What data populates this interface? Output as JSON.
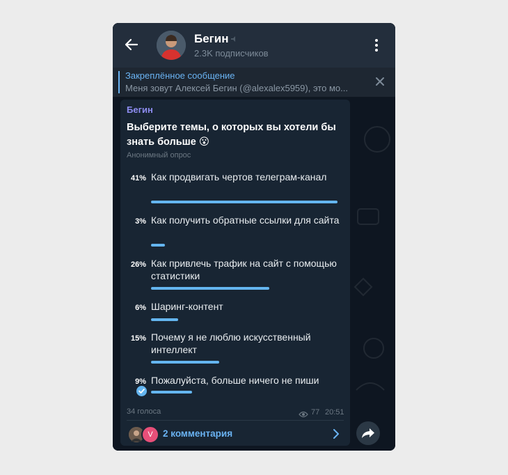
{
  "header": {
    "title": "Бегин",
    "subtitle": "2.3K подписчиков"
  },
  "pinned": {
    "title": "Закреплённое сообщение",
    "text": "Меня зовут Алексей Бегин (@alexalex5959), это мо..."
  },
  "message": {
    "author": "Бегин",
    "question": "Выберите темы, о которых вы хотели бы знать больше 😮",
    "poll_type": "Анонимный опрос",
    "options": [
      {
        "percent": "41%",
        "text": "Как продвигать чертов телеграм-канал",
        "fraction": 0.41
      },
      {
        "percent": "3%",
        "text": "Как получить обратные ссылки для сайта",
        "fraction": 0.03
      },
      {
        "percent": "26%",
        "text": "Как привлечь трафик на сайт с помощью статистики",
        "fraction": 0.26
      },
      {
        "percent": "6%",
        "text": "Шаринг-контент",
        "fraction": 0.06
      },
      {
        "percent": "15%",
        "text": "Почему я не люблю искусственный интеллект",
        "fraction": 0.15
      },
      {
        "percent": "9%",
        "text": "Пожалуйста, больше ничего не пиши",
        "fraction": 0.09,
        "selected": true
      }
    ],
    "votes": "34 голоса",
    "views": "77",
    "time": "20:51",
    "comments": "2 комментария",
    "comment_avatar_letter": "V"
  },
  "colors": {
    "accent": "#6ab3f3",
    "bar": "#64b5ef",
    "author": "#8d8cf0"
  }
}
